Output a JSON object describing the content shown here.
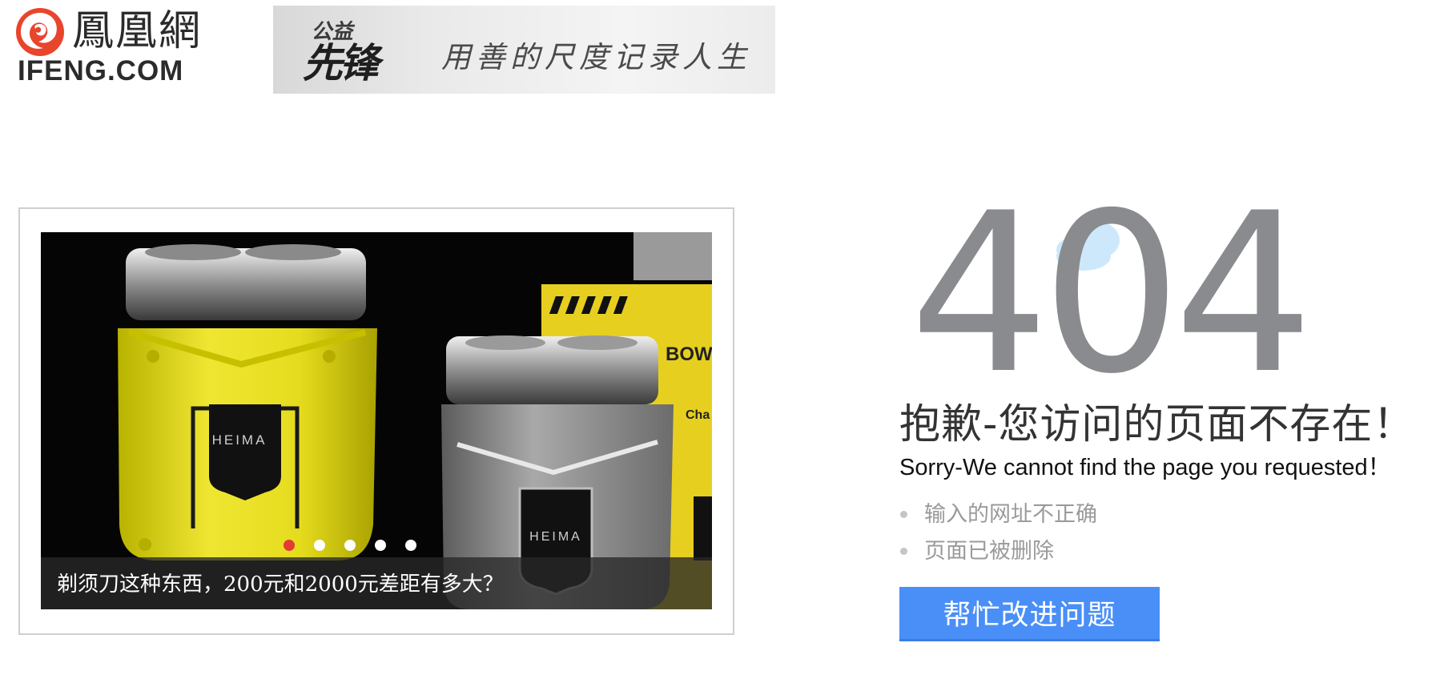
{
  "header": {
    "logo_cn": "鳳凰網",
    "logo_en": "IFENG.COM",
    "banner": {
      "brand_top": "公益",
      "brand_main": "先锋",
      "slogan": "用善的尺度记录人生"
    }
  },
  "slider": {
    "caption": "剃须刀这种东西，200元和2000元差距有多大？",
    "image_texts": [
      "HEIMA",
      "HEIMA"
    ],
    "dots_count": 5,
    "active_dot": 0,
    "accent_color": "#e53935"
  },
  "error": {
    "code": "404",
    "title_cn": "抱歉-您访问的页面不存在！",
    "title_en": "Sorry-We cannot find the page you requested！",
    "reasons": [
      "输入的网址不正确",
      "页面已被删除"
    ],
    "help_button": "帮忙改进问题",
    "code_color": "#8a8b8e",
    "cloud_color": "#cde8fb",
    "button_color": "#4a8ff7"
  }
}
